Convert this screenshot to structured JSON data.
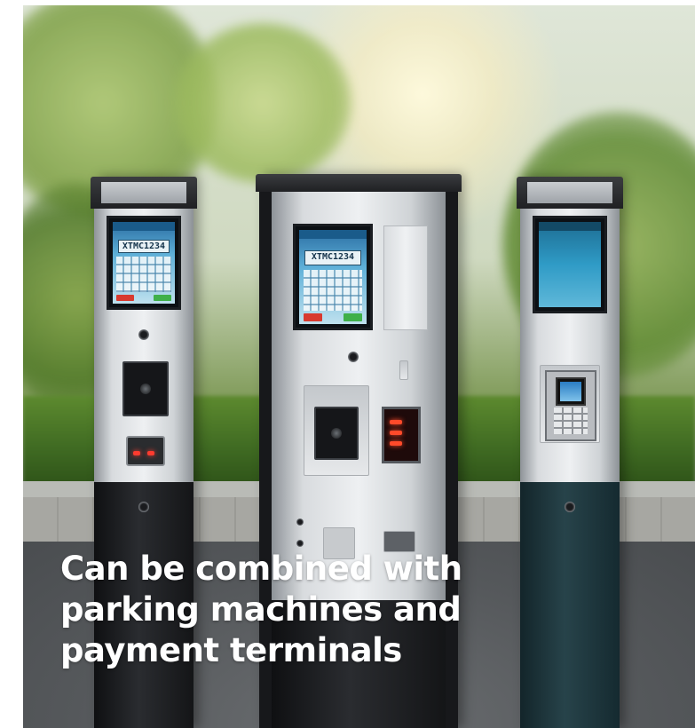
{
  "caption": {
    "lines": [
      "Can be combined with",
      "parking machines and",
      "payment terminals"
    ]
  },
  "machines": {
    "left": {
      "screen_plate": "XTMC1234"
    },
    "center": {
      "screen_plate": "XTMC1234"
    }
  },
  "colors": {
    "caption_text": "#ffffff",
    "led_red": "#ff3b2f",
    "screen_blue": "#5fb0d8",
    "steel": "#d8dbde"
  },
  "icons": [
    "scanner-lens-icon",
    "red-led-icon"
  ]
}
